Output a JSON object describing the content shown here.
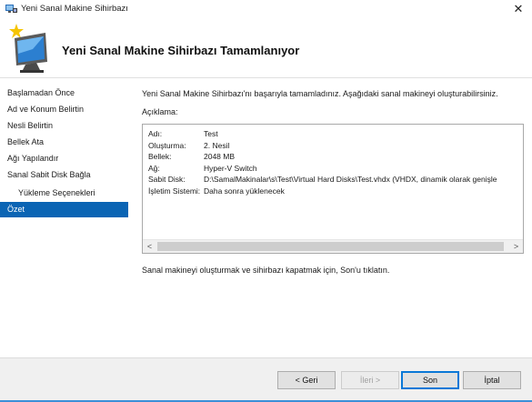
{
  "window": {
    "title": "Yeni Sanal Makine Sihirbazı",
    "close_glyph": "✕"
  },
  "header": {
    "title": "Yeni Sanal Makine Sihirbazı Tamamlanıyor",
    "icon": "wizard-monitor-icon"
  },
  "sidebar": {
    "items": [
      {
        "label": "Başlamadan Önce",
        "active": false,
        "sub": false
      },
      {
        "label": "Ad ve Konum Belirtin",
        "active": false,
        "sub": false
      },
      {
        "label": "Nesli Belirtin",
        "active": false,
        "sub": false
      },
      {
        "label": "Bellek Ata",
        "active": false,
        "sub": false
      },
      {
        "label": "Ağı Yapılandır",
        "active": false,
        "sub": false
      },
      {
        "label": "Sanal Sabit Disk Bağla",
        "active": false,
        "sub": false
      },
      {
        "label": "Yükleme Seçenekleri",
        "active": false,
        "sub": true
      },
      {
        "label": "Özet",
        "active": true,
        "sub": false
      }
    ]
  },
  "main": {
    "intro": "Yeni Sanal Makine Sihirbazı'nı başarıyla tamamladınız. Aşağıdaki sanal makineyi oluşturabilirsiniz.",
    "description_label": "Açıklama:",
    "details": [
      {
        "key": "Adı:",
        "value": "Test"
      },
      {
        "key": "Oluşturma:",
        "value": "2. Nesil"
      },
      {
        "key": "Bellek:",
        "value": "2048 MB"
      },
      {
        "key": "Ağ:",
        "value": "Hyper-V Switch"
      },
      {
        "key": "Sabit Disk:",
        "value": "D:\\SamalMakinalar\\s\\Test\\Virtual Hard Disks\\Test.vhdx (VHDX, dinamik olarak genişle"
      },
      {
        "key": "İşletim Sistemi:",
        "value": "Daha sonra yüklenecek"
      }
    ],
    "scroll_left": "<",
    "scroll_right": ">",
    "footer_note": "Sanal makineyi oluşturmak ve sihirbazı kapatmak için, Son'u tıklatın."
  },
  "buttons": {
    "back": "< Geri",
    "next": "İleri >",
    "finish": "Son",
    "cancel": "İptal"
  },
  "colors": {
    "accent": "#0a64b4",
    "active_text": "#ffffff",
    "bottom_bar": "#f0f0f0"
  }
}
